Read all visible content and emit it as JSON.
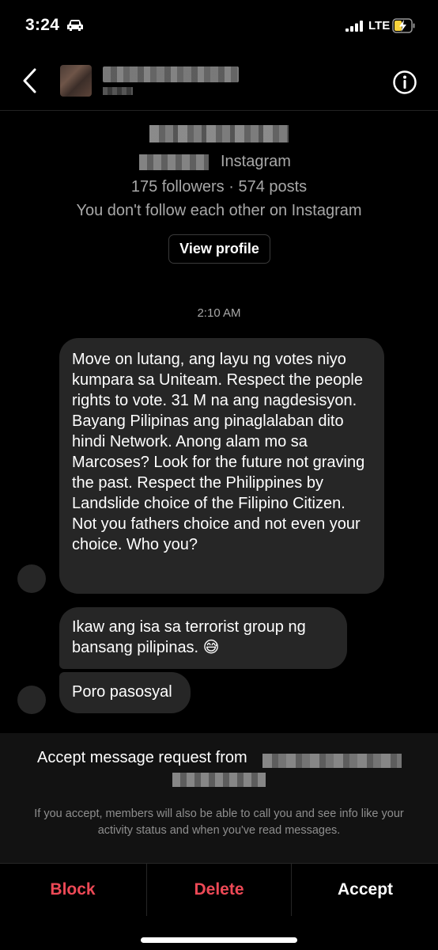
{
  "status_bar": {
    "time": "3:24",
    "network": "LTE",
    "icons": [
      "car-icon",
      "signal-bars-icon",
      "battery-charging-icon"
    ]
  },
  "header": {
    "icons": [
      "chevron-left-icon",
      "info-icon"
    ]
  },
  "profile": {
    "platform": "Instagram",
    "stats": "175 followers · 574 posts",
    "follow_status": "You don't follow each other on Instagram",
    "view_profile_label": "View profile"
  },
  "thread": {
    "timestamp": "2:10 AM",
    "messages": [
      {
        "text": "Move on lutang, ang layu ng votes niyo kumpara sa Uniteam. Respect the people rights to vote. 31 M na ang nagdesisyon. Bayang Pilipinas ang pinaglalaban dito hindi Network. Anong alam mo sa Marcoses? Look for the future not graving the past. Respect the Philippines by Landslide choice of the Filipino Citizen. Not you fathers choice and not even your choice. Who you?"
      },
      {
        "text": "Ikaw ang isa sa  terrorist group ng bansang pilipinas. 😅"
      },
      {
        "text": "Poro pasosyal"
      }
    ]
  },
  "request": {
    "title": "Accept message request from",
    "note": "If you accept, members will also be able to call you and see info like your activity status and when you've read messages."
  },
  "actions": {
    "block": "Block",
    "delete": "Delete",
    "accept": "Accept"
  },
  "colors": {
    "background": "#000000",
    "bubble": "#262626",
    "secondary_text": "#a8a8a8",
    "danger": "#ed4956"
  }
}
